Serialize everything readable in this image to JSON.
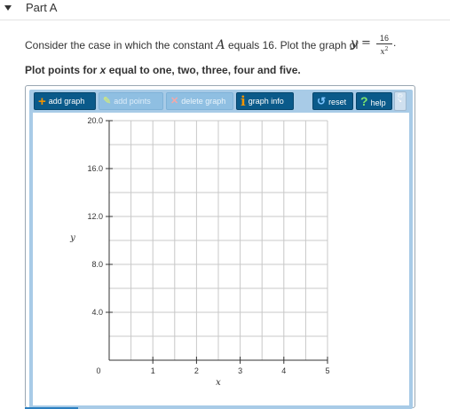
{
  "part": {
    "title": "Part A"
  },
  "question": {
    "prefix": "Consider the case in which the constant",
    "constant_symbol": "A",
    "middle": "equals 16. Plot the graph of",
    "y_symbol": "y",
    "equals": "=",
    "numerator": "16",
    "denominator_var": "x",
    "denominator_exp": "2",
    "suffix": "."
  },
  "instructions": {
    "prefix": "Plot points for",
    "var": "x",
    "suffix": "equal to one, two, three, four and five."
  },
  "toolbar": {
    "add_graph": "add graph",
    "add_points": "add points",
    "delete_graph": "delete graph",
    "graph_info": "graph info",
    "reset": "reset",
    "help": "help",
    "side": "©↗"
  },
  "icons": {
    "add_graph": "plus-icon",
    "add_points": "pencil-icon",
    "delete_graph": "x-icon",
    "graph_info": "info-icon",
    "reset": "reset-icon",
    "help": "question-icon"
  },
  "colors": {
    "toolbar_button": "#0a5a8a",
    "toolbar_button_disabled": "#8fbfe2",
    "frame": "#a8cbe7",
    "accent_orange": "#f29400",
    "grid": "#c8c8c8"
  },
  "chart_data": {
    "type": "scatter",
    "xlabel": "x",
    "ylabel": "y",
    "xlim": [
      0,
      5
    ],
    "ylim": [
      0,
      20
    ],
    "x_ticks": [
      "0",
      "1",
      "2",
      "3",
      "4",
      "5"
    ],
    "y_ticks": [
      "20.0",
      "16.0",
      "12.0",
      "8.0",
      "4.0"
    ],
    "y_tick_values": [
      20,
      16,
      12,
      8,
      4
    ],
    "x_tick_values": [
      0,
      1,
      2,
      3,
      4,
      5
    ],
    "grid": true,
    "series": []
  }
}
